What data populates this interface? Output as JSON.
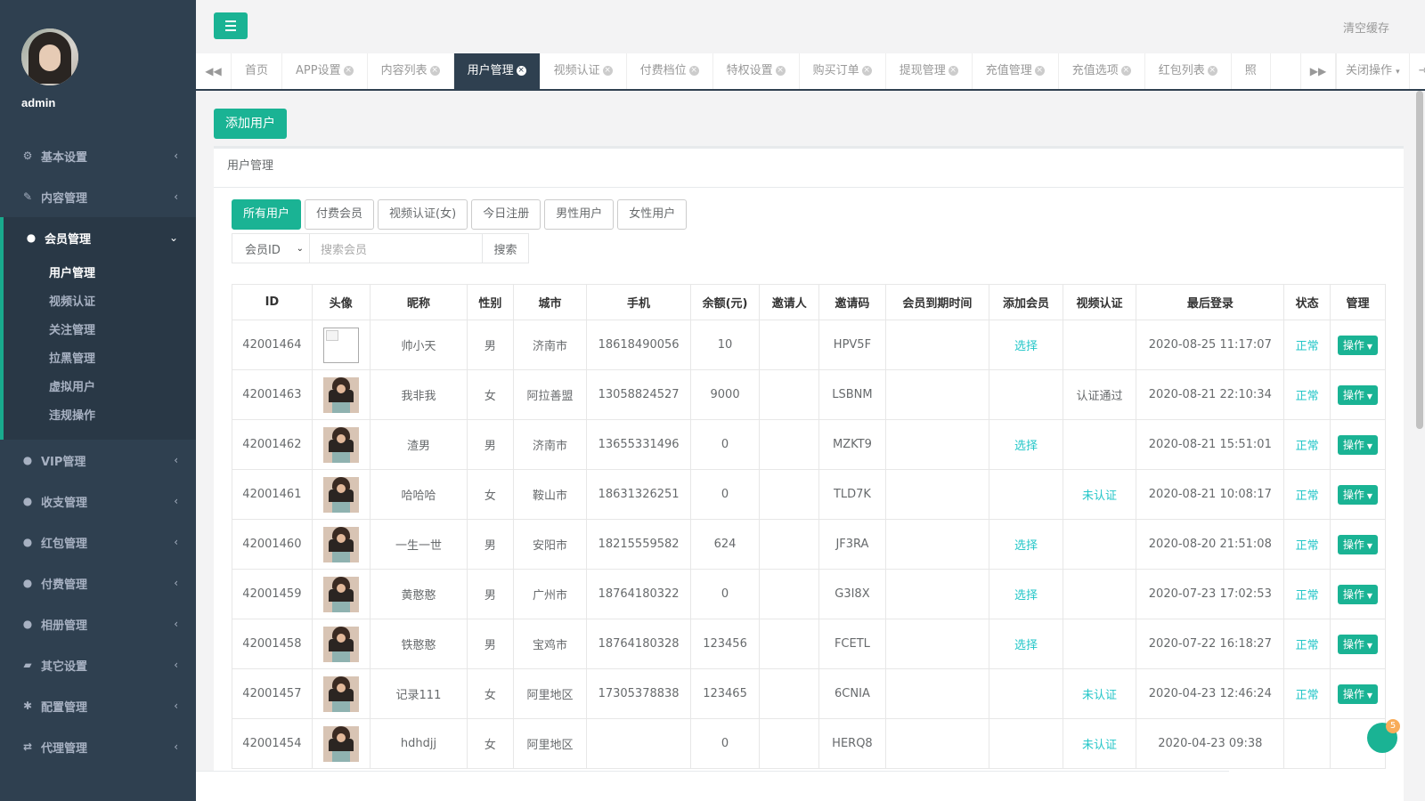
{
  "sidebar": {
    "admin_name": "admin",
    "menu": [
      {
        "label": "基本设置",
        "icon": "gear-icon",
        "glyph": "⚙",
        "arrow": "‹"
      },
      {
        "label": "内容管理",
        "icon": "edit-icon",
        "glyph": "✎",
        "arrow": "‹"
      },
      {
        "label": "会员管理",
        "icon": "user-icon",
        "glyph": "●",
        "arrow": "⌄",
        "active": true,
        "children": [
          "用户管理",
          "视频认证",
          "关注管理",
          "拉黑管理",
          "虚拟用户",
          "违规操作"
        ]
      },
      {
        "label": "VIP管理",
        "icon": "user-icon",
        "glyph": "●",
        "arrow": "‹"
      },
      {
        "label": "收支管理",
        "icon": "user-icon",
        "glyph": "●",
        "arrow": "‹"
      },
      {
        "label": "红包管理",
        "icon": "user-icon",
        "glyph": "●",
        "arrow": "‹"
      },
      {
        "label": "付费管理",
        "icon": "user-icon",
        "glyph": "●",
        "arrow": "‹"
      },
      {
        "label": "相册管理",
        "icon": "user-icon",
        "glyph": "●",
        "arrow": "‹"
      },
      {
        "label": "其它设置",
        "icon": "book-icon",
        "glyph": "▰",
        "arrow": "‹"
      },
      {
        "label": "配置管理",
        "icon": "asterisk-icon",
        "glyph": "✱",
        "arrow": "‹"
      },
      {
        "label": "代理管理",
        "icon": "exchange-icon",
        "glyph": "⇄",
        "arrow": "‹"
      }
    ]
  },
  "header": {
    "clear_cache": "清空缓存"
  },
  "tabs": {
    "prev_glyph": "◀◀",
    "next_glyph": "▶▶",
    "items": [
      {
        "label": "首页",
        "closable": false
      },
      {
        "label": "APP设置",
        "closable": true
      },
      {
        "label": "内容列表",
        "closable": true
      },
      {
        "label": "用户管理",
        "closable": true,
        "active": true
      },
      {
        "label": "视频认证",
        "closable": true
      },
      {
        "label": "付费档位",
        "closable": true
      },
      {
        "label": "特权设置",
        "closable": true
      },
      {
        "label": "购买订单",
        "closable": true
      },
      {
        "label": "提现管理",
        "closable": true
      },
      {
        "label": "充值管理",
        "closable": true
      },
      {
        "label": "充值选项",
        "closable": true
      },
      {
        "label": "红包列表",
        "closable": true
      },
      {
        "label": "照",
        "closable": false
      }
    ],
    "close_ops": "关闭操作",
    "logout": "退出"
  },
  "content": {
    "add_user": "添加用户",
    "panel_title": "用户管理",
    "filters": [
      "所有用户",
      "付费会员",
      "视频认证(女)",
      "今日注册",
      "男性用户",
      "女性用户"
    ],
    "search": {
      "select_value": "会员ID",
      "placeholder": "搜索会员",
      "button": "搜索"
    },
    "table": {
      "headers": [
        "ID",
        "头像",
        "昵称",
        "性别",
        "城市",
        "手机",
        "余额(元)",
        "邀请人",
        "邀请码",
        "会员到期时间",
        "添加会员",
        "视频认证",
        "最后登录",
        "状态",
        "管理"
      ],
      "rows": [
        {
          "id": "42001464",
          "avatar": "broken",
          "nickname": "帅小天",
          "gender": "男",
          "city": "济南市",
          "phone": "18618490056",
          "balance": "10",
          "inviter": "",
          "invite_code": "HPV5F",
          "expire": "",
          "add_vip": "选择",
          "video": "",
          "last_login": "2020-08-25 11:17:07",
          "status": "正常",
          "op": "操作"
        },
        {
          "id": "42001463",
          "avatar": "photo",
          "nickname": "我非我",
          "gender": "女",
          "city": "阿拉善盟",
          "phone": "13058824527",
          "balance": "9000",
          "inviter": "",
          "invite_code": "LSBNM",
          "expire": "",
          "add_vip": "",
          "video": "认证通过",
          "last_login": "2020-08-21 22:10:34",
          "status": "正常",
          "op": "操作"
        },
        {
          "id": "42001462",
          "avatar": "photo",
          "nickname": "渣男",
          "gender": "男",
          "city": "济南市",
          "phone": "13655331496",
          "balance": "0",
          "inviter": "",
          "invite_code": "MZKT9",
          "expire": "",
          "add_vip": "选择",
          "video": "",
          "last_login": "2020-08-21 15:51:01",
          "status": "正常",
          "op": "操作"
        },
        {
          "id": "42001461",
          "avatar": "photo",
          "nickname": "哈哈哈",
          "gender": "女",
          "city": "鞍山市",
          "phone": "18631326251",
          "balance": "0",
          "inviter": "",
          "invite_code": "TLD7K",
          "expire": "",
          "add_vip": "",
          "video": "未认证",
          "last_login": "2020-08-21 10:08:17",
          "status": "正常",
          "op": "操作"
        },
        {
          "id": "42001460",
          "avatar": "photo",
          "nickname": "一生一世",
          "gender": "男",
          "city": "安阳市",
          "phone": "18215559582",
          "balance": "624",
          "inviter": "",
          "invite_code": "JF3RA",
          "expire": "",
          "add_vip": "选择",
          "video": "",
          "last_login": "2020-08-20 21:51:08",
          "status": "正常",
          "op": "操作"
        },
        {
          "id": "42001459",
          "avatar": "photo",
          "nickname": "黄憨憨",
          "gender": "男",
          "city": "广州市",
          "phone": "18764180322",
          "balance": "0",
          "inviter": "",
          "invite_code": "G3I8X",
          "expire": "",
          "add_vip": "选择",
          "video": "",
          "last_login": "2020-07-23 17:02:53",
          "status": "正常",
          "op": "操作"
        },
        {
          "id": "42001458",
          "avatar": "photo",
          "nickname": "铁憨憨",
          "gender": "男",
          "city": "宝鸡市",
          "phone": "18764180328",
          "balance": "123456",
          "inviter": "",
          "invite_code": "FCETL",
          "expire": "",
          "add_vip": "选择",
          "video": "",
          "last_login": "2020-07-22 16:18:27",
          "status": "正常",
          "op": "操作"
        },
        {
          "id": "42001457",
          "avatar": "photo",
          "nickname": "记录111",
          "gender": "女",
          "city": "阿里地区",
          "phone": "17305378838",
          "balance": "123465",
          "inviter": "",
          "invite_code": "6CNIA",
          "expire": "",
          "add_vip": "",
          "video": "未认证",
          "last_login": "2020-04-23 12:46:24",
          "status": "正常",
          "op": "操作"
        },
        {
          "id": "42001454",
          "avatar": "photo",
          "nickname": "hdhdjj",
          "gender": "女",
          "city": "阿里地区",
          "phone": "",
          "balance": "0",
          "inviter": "",
          "invite_code": "HERQ8",
          "expire": "",
          "add_vip": "",
          "video": "未认证",
          "last_login": "2020-04-23 09:38",
          "status": "",
          "op": ""
        }
      ]
    }
  },
  "chat_badge": "5",
  "colors": {
    "primary": "#1ab394",
    "sidebar": "#2f4050",
    "link": "#23c6c8"
  }
}
